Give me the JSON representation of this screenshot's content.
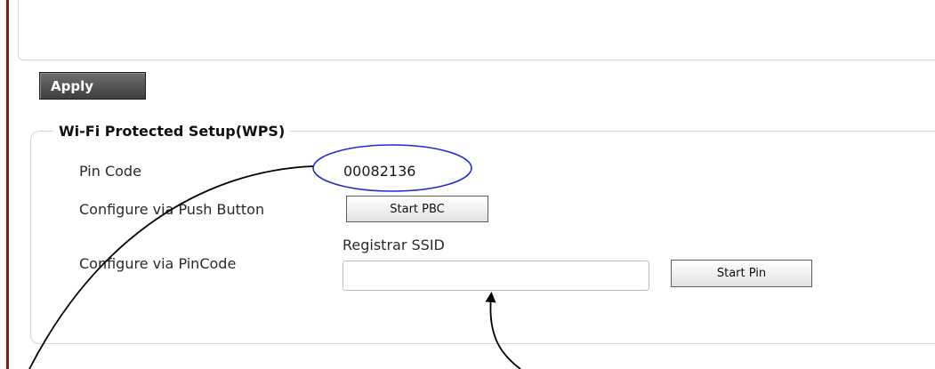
{
  "apply_button": {
    "label": "Apply"
  },
  "wps": {
    "legend": "Wi-Fi Protected Setup(WPS)",
    "pin_code_label": "Pin Code",
    "pin_code_value": "00082136",
    "push_button_label": "Configure via Push Button",
    "start_pbc_label": "Start PBC",
    "pincode_label": "Configure via PinCode",
    "registrar_ssid_label": "Registrar SSID",
    "registrar_ssid_value": "",
    "start_pin_label": "Start Pin"
  },
  "colors": {
    "annotation_ellipse": "#1f2bd6",
    "side_rule": "#8b1a1a",
    "panel_border": "#cfd5dc"
  }
}
